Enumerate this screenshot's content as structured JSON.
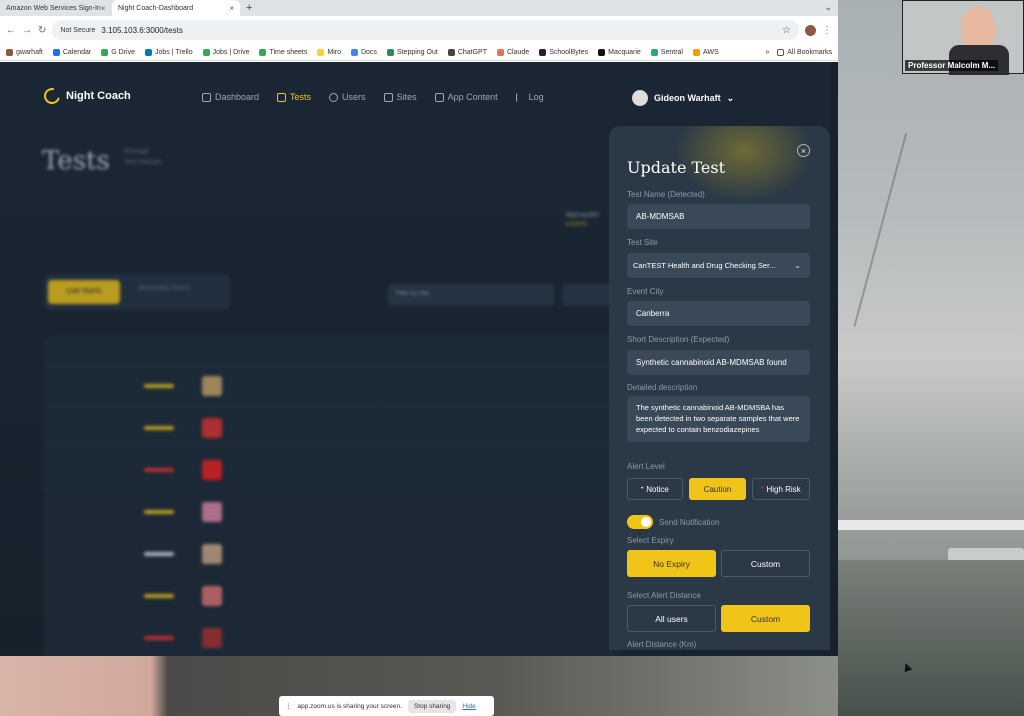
{
  "browser": {
    "tabs": [
      {
        "label": "Amazon Web Services Sign-In"
      },
      {
        "label": "Night Coach-Dashboard"
      }
    ],
    "security": "Not Secure",
    "url": "3.105.103.6:3000/tests",
    "bookmarks": [
      "gwarhaft",
      "Calendar",
      "G Drive",
      "Jobs | Trello",
      "Jobs | Drive",
      "Time sheets",
      "Miro",
      "Docs",
      "Stepping Out",
      "ChatGPT",
      "Claude",
      "SchoolBytes",
      "Macquarie",
      "Sentral",
      "AWS"
    ],
    "all_bookmarks": "All Bookmarks"
  },
  "video": {
    "name": "Professor Malcolm M..."
  },
  "app": {
    "brand": "Night Coach",
    "nav": [
      {
        "label": "Dashboard"
      },
      {
        "label": "Tests"
      },
      {
        "label": "Users"
      },
      {
        "label": "Sites"
      },
      {
        "label": "App Content"
      },
      {
        "label": "Log"
      }
    ],
    "user": "Gideon Warhaft",
    "page_title": "Tests",
    "subtitle_1": "Manage",
    "subtitle_2": "Test Results",
    "alert_line_1": "RED ALERT",
    "alert_line_2": "4 DAYS",
    "toggle_live": "LIVE TESTS",
    "toggle_archived": "ARCHIVED TESTS",
    "filter_site": "Filter by Site"
  },
  "panel": {
    "title": "Update Test",
    "test_name_label": "Test Name (Detected)",
    "test_name_value": "AB-MDMSAB",
    "test_site_label": "Test Site",
    "test_site_value": "CanTEST Health and Drug Checking Ser...",
    "event_city_label": "Event City",
    "event_city_value": "Canberra",
    "short_desc_label": "Short Description (Expected)",
    "short_desc_value": "Synthetic cannabinoid AB-MDMSAB found",
    "detailed_desc_label": "Detailed description",
    "detailed_desc_value": "The synthetic cannabinoid AB-MDMSBA has been detected in two separate samples that were expected to contain benzodiazepines",
    "alert_level_label": "Alert Level",
    "alert_notice": "Notice",
    "alert_caution": "Caution",
    "alert_high": "High Risk",
    "send_notification": "Send Notification",
    "expiry_label": "Select Expiry",
    "expiry_none": "No Expiry",
    "expiry_custom": "Custom",
    "distance_label": "Select Alert Distance",
    "distance_all": "All users",
    "distance_custom": "Custom",
    "distance_km_label": "Alert Distance (Km)"
  },
  "zoom": {
    "message": "app.zoom.us is sharing your screen.",
    "stop": "Stop sharing",
    "hide": "Hide"
  },
  "colors": {
    "accent": "#f0c419",
    "app_bg": "#17222d",
    "panel_bg": "#2b3946"
  }
}
